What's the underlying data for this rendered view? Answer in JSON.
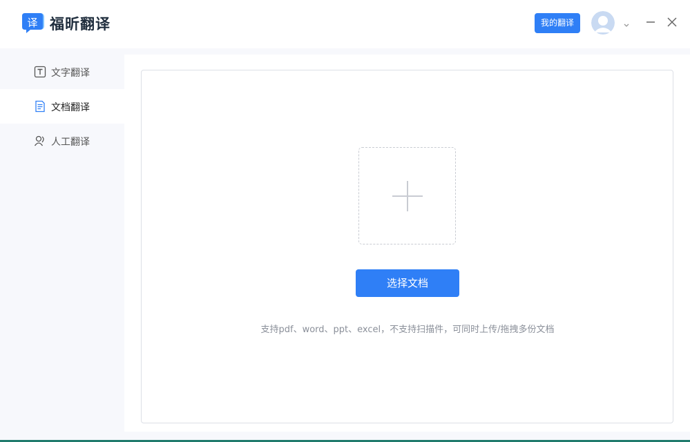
{
  "app": {
    "title": "福昕翻译",
    "logo_glyph": "译",
    "brand_color": "#2f7ff6"
  },
  "header": {
    "my_translations_label": "我的翻译"
  },
  "sidebar": {
    "items": [
      {
        "label": "文字翻译",
        "icon": "text-t-icon",
        "active": false
      },
      {
        "label": "文档翻译",
        "icon": "document-icon",
        "active": true
      },
      {
        "label": "人工翻译",
        "icon": "human-translation-icon",
        "active": false
      }
    ]
  },
  "upload": {
    "select_button_label": "选择文档",
    "hint": "支持pdf、word、ppt、excel，不支持扫描件，可同时上传/拖拽多份文档"
  }
}
